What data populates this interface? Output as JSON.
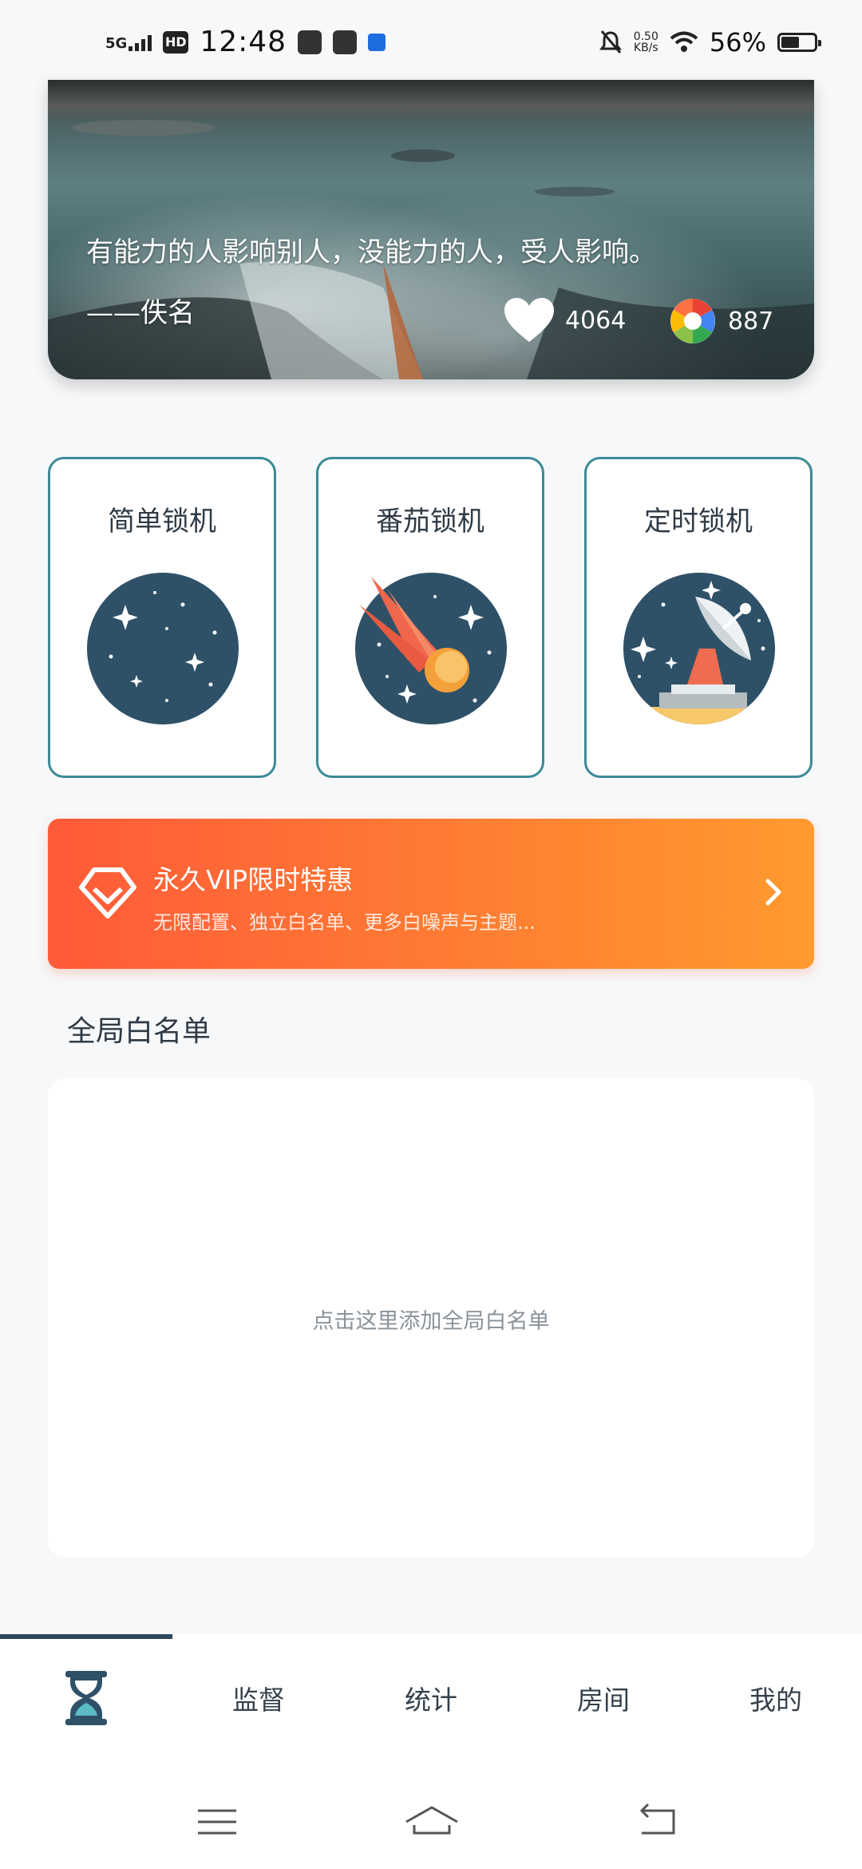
{
  "status_bar": {
    "network": "5G",
    "hd": "HD",
    "time": "12:48",
    "speed_value": "0.50",
    "speed_unit": "KB/s",
    "battery_percent": "56%",
    "battery_level": 0.56
  },
  "quote": {
    "text": "有能力的人影响别人，没能力的人，受人影响。",
    "author": "——佚名",
    "likes": "4064",
    "shares": "887"
  },
  "modes": [
    {
      "label": "简单锁机",
      "icon": "starry-planet-icon"
    },
    {
      "label": "番茄锁机",
      "icon": "comet-icon"
    },
    {
      "label": "定时锁机",
      "icon": "satellite-dish-icon"
    }
  ],
  "vip": {
    "title": "永久VIP限时特惠",
    "subtitle": "无限配置、独立白名单、更多白噪声与主题...",
    "icon": "diamond-icon"
  },
  "whitelist": {
    "title": "全局白名单",
    "hint": "点击这里添加全局白名单"
  },
  "nav": {
    "items": [
      {
        "label": "",
        "icon": "hourglass-icon",
        "active": true
      },
      {
        "label": "监督"
      },
      {
        "label": "统计"
      },
      {
        "label": "房间"
      },
      {
        "label": "我的"
      }
    ]
  },
  "colors": {
    "accent": "#3c8a96",
    "nav_indicator": "#2f4a5a",
    "vip_start": "#ff5a39",
    "vip_end": "#ff9a2e",
    "planet": "#2e5168"
  }
}
